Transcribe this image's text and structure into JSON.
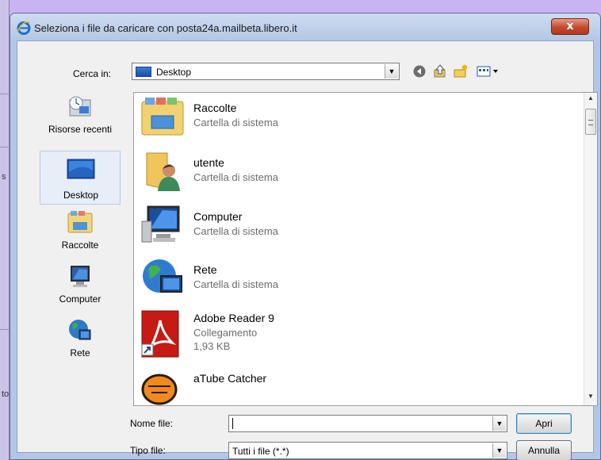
{
  "dialog": {
    "title": "Seleziona i file da caricare con posta24a.mailbeta.libero.it",
    "close_label": "x"
  },
  "background": {
    "fragment1": "s",
    "fragment2": "to"
  },
  "lookin": {
    "label": "Cerca in:",
    "value": "Desktop"
  },
  "toolbar": {
    "icons": [
      "back-icon",
      "up-folder-icon",
      "new-folder-icon",
      "views-menu-icon"
    ]
  },
  "places": [
    {
      "label": "Risorse recenti",
      "icon": "recent-places-icon"
    },
    {
      "label": "Desktop",
      "icon": "desktop-icon",
      "selected": true
    },
    {
      "label": "Raccolte",
      "icon": "libraries-icon"
    },
    {
      "label": "Computer",
      "icon": "computer-icon"
    },
    {
      "label": "Rete",
      "icon": "network-icon"
    }
  ],
  "files": [
    {
      "name": "Raccolte",
      "type": "Cartella di sistema",
      "icon": "libraries-folder-icon"
    },
    {
      "name": "utente",
      "type": "Cartella di sistema",
      "icon": "user-folder-icon"
    },
    {
      "name": "Computer",
      "type": "Cartella di sistema",
      "icon": "computer-icon"
    },
    {
      "name": "Rete",
      "type": "Cartella di sistema",
      "icon": "network-icon"
    },
    {
      "name": "Adobe Reader 9",
      "type": "Collegamento",
      "size": "1,93 KB",
      "icon": "adobe-reader-icon"
    },
    {
      "name": "aTube Catcher",
      "icon": "atube-catcher-icon"
    }
  ],
  "filename": {
    "label": "Nome file:",
    "value": ""
  },
  "filetype": {
    "label": "Tipo file:",
    "value": "Tutti i file (*.*)"
  },
  "buttons": {
    "open": "Apri",
    "cancel": "Annulla"
  },
  "colors": {
    "window_frame": "#b4c6e6",
    "close_button": "#c24a2e",
    "background": "#c9b3f2"
  }
}
